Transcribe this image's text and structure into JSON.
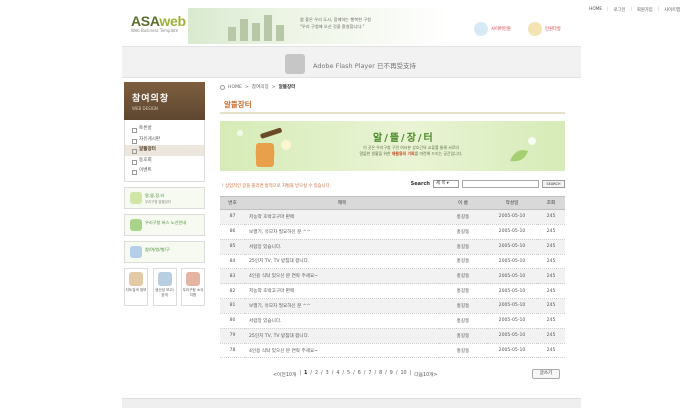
{
  "header": {
    "logo_main": "ASA",
    "logo_accent": "web",
    "logo_sub": "Web Business Template",
    "banner_text_line1": "참 좋은 우리 도시, 함께하는 행복한 구청",
    "banner_text_line2": "\"우리 구청에 오신 것을 환영합니다.\"",
    "nav": [
      "HOME",
      "로그인",
      "회원가입",
      "사이트맵"
    ],
    "quick1": "사이버민원",
    "quick2": "민원다방",
    "colors": {
      "logo": "#5a6d2e",
      "accent": "#9fb03a"
    }
  },
  "flash": {
    "message": "Adobe Flash Player 已不再受支持"
  },
  "sidebar": {
    "title": "참여의창",
    "title_en": "WEB DESIGN",
    "items": [
      "토론방",
      "자유게시판",
      "알뜰장터",
      "동호회",
      "이벤트"
    ],
    "active_index": 2,
    "banner1": "알.뜰.장.터",
    "banner1_sub": "우리구청 알뜰장터",
    "banner2": "우리구청 버스 노선안내",
    "banner3": "참/여/방/향/구",
    "icons": [
      "지도검색 정보",
      "생산성 보고/공개",
      "우리구청 소식지함"
    ]
  },
  "main": {
    "crumb_home": "HOME",
    "crumb_mid": "참여의장",
    "crumb_current": "알뜰장터",
    "title": "알뜰장터",
    "hero_title": "알/뜰/장/터",
    "hero_desc1": "이 곳은 우리구청 구민 여러분 상호간의 교류를 통해 서로의",
    "hero_desc2_pre": "알뜰한 생활을 위한 ",
    "hero_desc2_em": "재활용의 기회",
    "hero_desc2_post": "를 마련해 드리는 공간입니다.",
    "notice": "! 상업적인 글을 올리면 법적으로 처벌을 받으실 수 있습니다.",
    "search_label": "Search",
    "search_select": "제 목 ▾",
    "search_button": "SEARCH",
    "columns": [
      "번호",
      "제목",
      "이 름",
      "작성일",
      "조회"
    ],
    "rows": [
      [
        "87",
        "저농약 호박고구마 판매",
        "홍길동",
        "2005-05-10",
        "245"
      ],
      [
        "86",
        "보행기, 유모차 필요하신 분 ^^",
        "홍길동",
        "2005-05-10",
        "245"
      ],
      [
        "85",
        "서랍장 있습니다.",
        "홍길동",
        "2005-05-10",
        "245"
      ],
      [
        "84",
        "25인치 TV, TV 받침대 팝니다.",
        "홍길동",
        "2005-05-10",
        "245"
      ],
      [
        "83",
        "4인용 식탁 있으신 분 연락 주세요~",
        "홍길동",
        "2005-05-10",
        "245"
      ],
      [
        "82",
        "저농약 호박고구마 판매",
        "홍길동",
        "2005-05-10",
        "245"
      ],
      [
        "81",
        "보행기, 유모차 필요하신 분 ^^",
        "홍길동",
        "2005-05-10",
        "245"
      ],
      [
        "80",
        "서랍장 있습니다.",
        "홍길동",
        "2005-05-10",
        "245"
      ],
      [
        "79",
        "25인치 TV, TV 받침대 팝니다.",
        "홍길동",
        "2005-05-10",
        "245"
      ],
      [
        "78",
        "4인용 식탁 있으신 분 연락 주세요~",
        "홍길동",
        "2005-05-10",
        "245"
      ]
    ],
    "pager_prev": "<이전10개",
    "pager_pages": [
      "1",
      "2",
      "3",
      "4",
      "5",
      "6",
      "7",
      "8",
      "9",
      "10"
    ],
    "pager_current": "1",
    "pager_next": "다음10개>",
    "write_button": "글쓰기"
  }
}
